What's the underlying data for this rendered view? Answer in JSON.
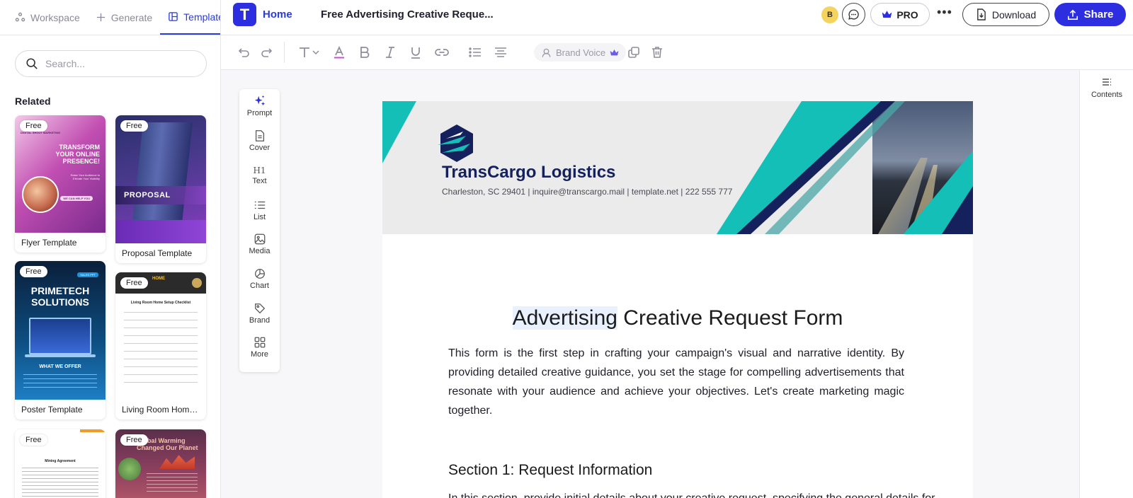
{
  "left_panel": {
    "tabs": [
      {
        "label": "Workspace",
        "icon": "workspace-icon",
        "active": false
      },
      {
        "label": "Generate",
        "icon": "plus-icon",
        "active": false
      },
      {
        "label": "Templates",
        "icon": "templates-icon",
        "active": true
      }
    ],
    "search": {
      "placeholder": "Search..."
    },
    "related_heading": "Related",
    "templates": [
      {
        "caption": "Flyer Template",
        "badge": "Free",
        "thumb_lines": [
          "DIGITAL SHOUT MARKETING",
          "TRANSFORM YOUR ONLINE PRESENCE!",
          "WE CAN HELP YOU"
        ]
      },
      {
        "caption": "Proposal Template",
        "badge": "Free",
        "thumb_lines": [
          "PROPOSAL"
        ]
      },
      {
        "caption": "Poster Template",
        "badge": "Free",
        "thumb_lines": [
          "PRIMETECH SOLUTIONS",
          "WHAT WE OFFER"
        ]
      },
      {
        "caption": "Living Room Home ...",
        "badge": "Free",
        "thumb_lines": [
          "HOME",
          "Living Room Home Setup Checklist"
        ]
      },
      {
        "caption": "",
        "badge": "Free",
        "thumb_lines": [
          "Mining Agreement"
        ]
      },
      {
        "caption": "",
        "badge": "Free",
        "thumb_lines": [
          "Global Warming Changed Our Planet"
        ]
      }
    ]
  },
  "topbar": {
    "logo_letter": "T",
    "home_label": "Home",
    "doc_title": "Free Advertising Creative Reque...",
    "avatar_initial": "B",
    "pro_label": "PRO",
    "more_label": "•••",
    "download_label": "Download",
    "share_label": "Share"
  },
  "toolbar": {
    "brand_voice_label": "Brand Voice",
    "icons": [
      "undo-icon",
      "redo-icon",
      "text-style-icon",
      "font-color-icon",
      "bold-icon",
      "italic-icon",
      "underline-icon",
      "link-icon",
      "bullet-list-icon",
      "align-icon",
      "duplicate-icon",
      "delete-icon"
    ]
  },
  "right_sidebar": {
    "contents_label": "Contents"
  },
  "insert_panel": {
    "items": [
      {
        "label": "Prompt",
        "icon": "sparkle-icon"
      },
      {
        "label": "Cover",
        "icon": "cover-icon"
      },
      {
        "label": "Text",
        "icon": "h1-icon",
        "glyph": "H1"
      },
      {
        "label": "List",
        "icon": "list-icon"
      },
      {
        "label": "Media",
        "icon": "media-icon"
      },
      {
        "label": "Chart",
        "icon": "chart-icon"
      },
      {
        "label": "Brand",
        "icon": "brand-icon"
      },
      {
        "label": "More",
        "icon": "grid-icon"
      }
    ]
  },
  "document": {
    "company_name": "TransCargo Logistics",
    "company_info": "Charleston, SC 29401 | inquire@transcargo.mail | template.net | 222 555 777",
    "title_highlight": "Advertising",
    "title_rest": " Creative Request Form",
    "intro": "This form is the first step in crafting your campaign's visual and narrative identity. By providing detailed creative guidance, you set the stage for compelling advertisements that resonate with your audience and achieve your objectives. Let's create marketing magic together.",
    "section_heading": "Section 1: Request Information",
    "cut_line": "In this section, provide initial details about your creative request, specifying the general details for..."
  },
  "colors": {
    "accent": "#2d2ee0",
    "teal": "#14bfb8",
    "navy": "#14215c"
  }
}
